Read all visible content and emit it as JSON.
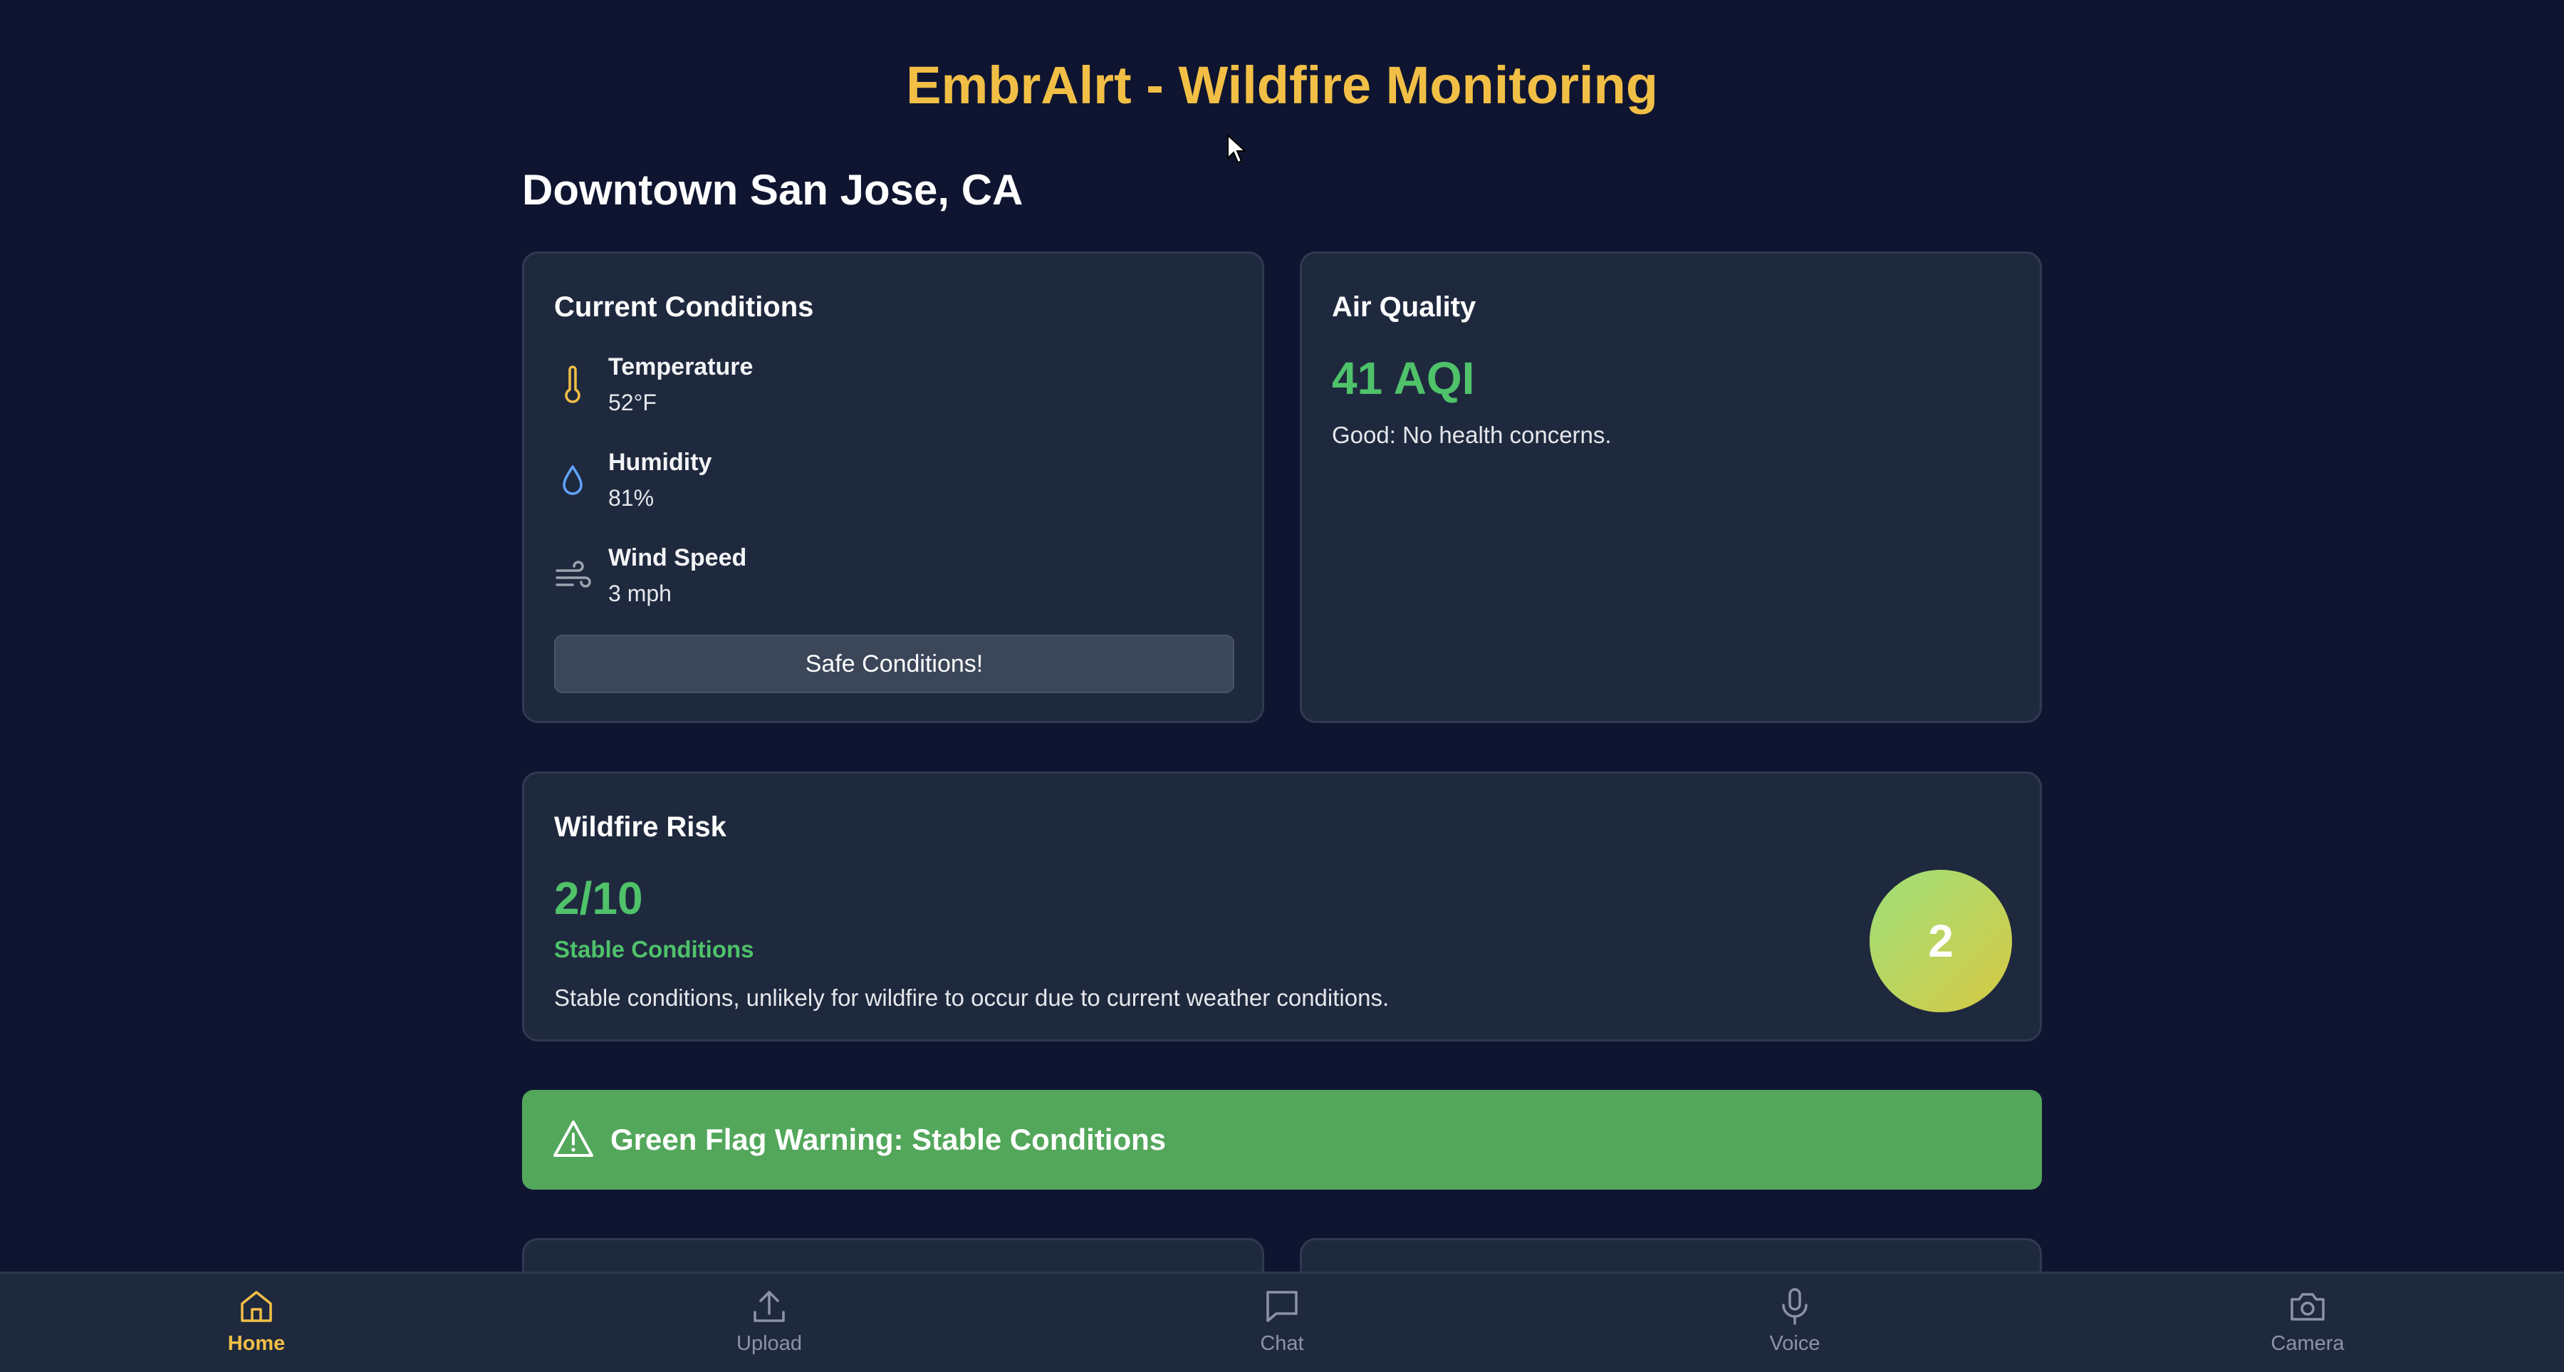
{
  "app": {
    "title": "EmbrAlrt - Wildfire Monitoring",
    "location": "Downtown San Jose, CA"
  },
  "conditions": {
    "title": "Current Conditions",
    "items": [
      {
        "label": "Temperature",
        "value": "52°F",
        "icon": "thermometer-icon"
      },
      {
        "label": "Humidity",
        "value": "81%",
        "icon": "droplet-icon"
      },
      {
        "label": "Wind Speed",
        "value": "3 mph",
        "icon": "wind-icon"
      }
    ],
    "button_label": "Safe Conditions!"
  },
  "air_quality": {
    "title": "Air Quality",
    "value": "41 AQI",
    "description": "Good: No health concerns."
  },
  "wildfire_risk": {
    "title": "Wildfire Risk",
    "score": "2/10",
    "status": "Stable Conditions",
    "description": "Stable conditions, unlikely for wildfire to occur due to current weather conditions.",
    "badge": "2"
  },
  "warning": {
    "text": "Green Flag Warning: Stable Conditions",
    "icon": "alert-triangle-icon"
  },
  "nav": {
    "items": [
      {
        "label": "Home",
        "icon": "home-icon",
        "active": true
      },
      {
        "label": "Upload",
        "icon": "upload-icon",
        "active": false
      },
      {
        "label": "Chat",
        "icon": "chat-icon",
        "active": false
      },
      {
        "label": "Voice",
        "icon": "microphone-icon",
        "active": false
      },
      {
        "label": "Camera",
        "icon": "camera-icon",
        "active": false
      }
    ]
  },
  "colors": {
    "background": "#0f1530",
    "card": "#1f293e",
    "accent": "#f2bf46",
    "good": "#4fc26a",
    "banner": "#53a75b"
  }
}
